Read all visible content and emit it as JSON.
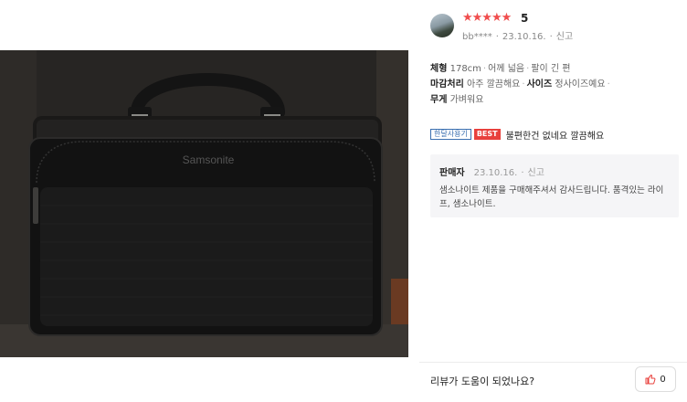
{
  "review": {
    "rating_stars": "★★★★★",
    "rating_value": "5",
    "user": "bb****",
    "date": "23.10.16.",
    "report_label": "신고",
    "info": {
      "line1_key1": "체형",
      "line1_val1": "178cm",
      "line1_val2": "어께 넓음",
      "line1_val3": "팔이 긴 편",
      "line2_key1": "마감처리",
      "line2_val1": "아주 깔끔해요",
      "line2_key2": "사이즈",
      "line2_val2": "정사이즈예요",
      "line3_key1": "무게",
      "line3_val1": "가벼워요"
    },
    "badge_outline": "한달사용기",
    "badge_best": "BEST",
    "comment": "불편한건 없네요 깔끔해요"
  },
  "seller_reply": {
    "who": "판매자",
    "date": "23.10.16.",
    "report_label": "신고",
    "message": "샘소나이트 제품을 구매해주셔서 감사드립니다. 품격있는 라이프, 샘소나이트."
  },
  "photo": {
    "brand_text": "Samsonite"
  },
  "footer": {
    "helpful_question": "리뷰가 도움이 되었나요?",
    "helpful_count": "0"
  },
  "colors": {
    "star": "#f04d4d",
    "best_badge": "#e8403c",
    "outline_badge": "#3a6fb0"
  }
}
